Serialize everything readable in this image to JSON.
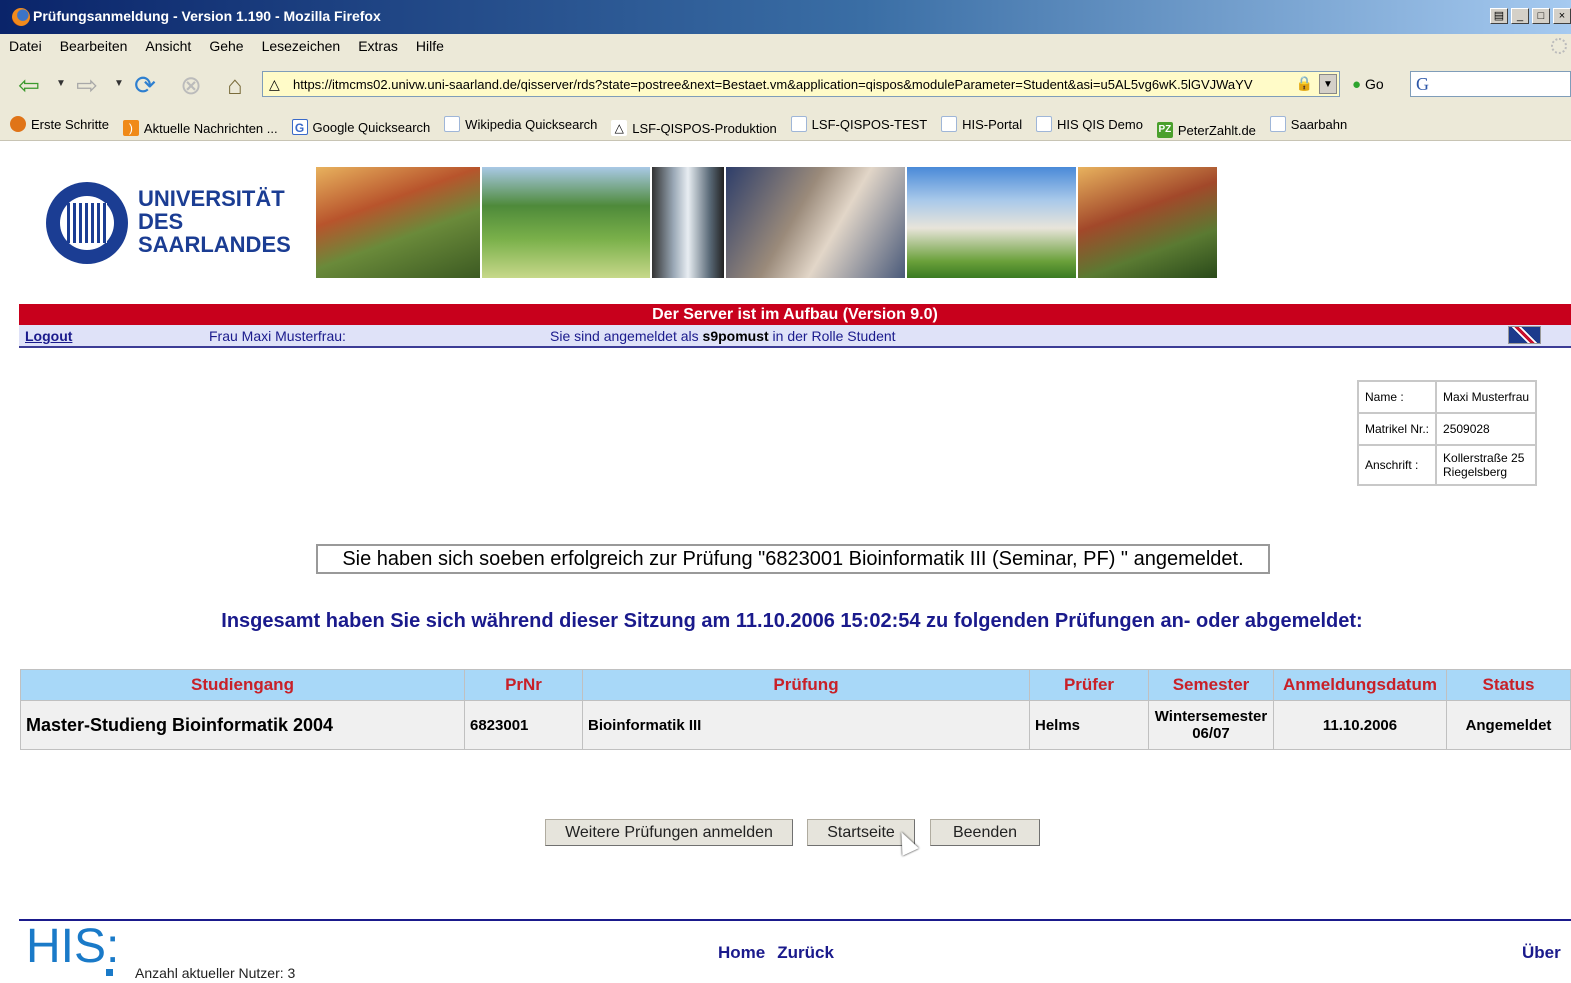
{
  "window": {
    "title": "Prüfungsanmeldung - Version 1.190 - Mozilla Firefox"
  },
  "menu": [
    "Datei",
    "Bearbeiten",
    "Ansicht",
    "Gehe",
    "Lesezeichen",
    "Extras",
    "Hilfe"
  ],
  "nav": {
    "url": "https://itmcms02.univw.uni-saarland.de/qisserver/rds?state=postree&next=Bestaet.vm&application=qispos&moduleParameter=Student&asi=u5AL5vg6wK.5lGVJWaYV",
    "go_label": "Go"
  },
  "bookmarks": [
    {
      "label": "Erste Schritte",
      "icon": "firefox-icon"
    },
    {
      "label": "Aktuelle Nachrichten ...",
      "icon": "rss-icon"
    },
    {
      "label": "Google Quicksearch",
      "icon": "google-icon"
    },
    {
      "label": "Wikipedia Quicksearch",
      "icon": "page-icon"
    },
    {
      "label": "LSF-QISPOS-Produktion",
      "icon": "tux-icon"
    },
    {
      "label": "LSF-QISPOS-TEST",
      "icon": "page-icon"
    },
    {
      "label": "HIS-Portal",
      "icon": "page-icon"
    },
    {
      "label": "HIS QIS Demo",
      "icon": "page-icon"
    },
    {
      "label": "PeterZahlt.de",
      "icon": "pz-icon"
    },
    {
      "label": "Saarbahn",
      "icon": "page-icon"
    }
  ],
  "header": {
    "uni_line1": "UNIVERSITÄT",
    "uni_line2": "DES",
    "uni_line3": "SAARLANDES",
    "server_notice": "Der Server ist im Aufbau (Version 9.0)",
    "logout": "Logout",
    "person": "Frau Maxi Musterfrau:",
    "login_prefix": "Sie sind angemeldet als ",
    "login_user": "s9pomust",
    "login_suffix": " in der Rolle Student"
  },
  "student": {
    "name_label": "Name :",
    "name": "Maxi Musterfrau",
    "matrikel_label": "Matrikel Nr.:",
    "matrikel": "2509028",
    "address_label": "Anschrift :",
    "address_line1": "Kollerstraße 25",
    "address_line2": "Riegelsberg"
  },
  "messages": {
    "success": "Sie haben sich soeben erfolgreich zur Prüfung \"6823001 Bioinformatik III (Seminar, PF) \" angemeldet.",
    "session": "Insgesamt haben Sie sich während dieser Sitzung am 11.10.2006 15:02:54 zu folgenden Prüfungen an- oder abgemeldet:"
  },
  "table": {
    "headers": [
      "Studiengang",
      "PrNr",
      "Prüfung",
      "Prüfer",
      "Semester",
      "Anmeldungsdatum",
      "Status"
    ],
    "rows": [
      {
        "studiengang": "Master-Studieng Bioinformatik 2004",
        "prnr": "6823001",
        "pruefung": "Bioinformatik III",
        "pruefer": "Helms",
        "semester1": "Wintersemester",
        "semester2": "06/07",
        "datum": "11.10.2006",
        "status": "Angemeldet"
      }
    ]
  },
  "buttons": {
    "more": "Weitere Prüfungen anmelden",
    "start": "Startseite",
    "end": "Beenden"
  },
  "footer": {
    "logo": "HIS:",
    "users": "Anzahl aktueller Nutzer: 3",
    "home": "Home",
    "back": "Zurück",
    "about": "Über"
  }
}
